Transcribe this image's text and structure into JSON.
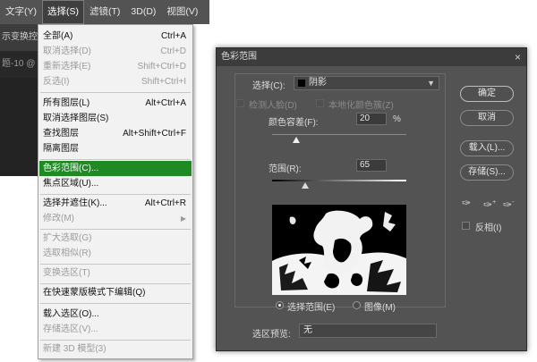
{
  "menubar": {
    "items": [
      {
        "label": "文字(Y)"
      },
      {
        "label": "选择(S)"
      },
      {
        "label": "滤镜(T)"
      },
      {
        "label": "3D(D)"
      },
      {
        "label": "视图(V)"
      }
    ],
    "active_index": 1
  },
  "options_bar": {
    "text": "示变换控件"
  },
  "document_tab": {
    "text": "题-10 @"
  },
  "select_menu": {
    "items": [
      {
        "label": "全部(A)",
        "shortcut": "Ctrl+A",
        "enabled": true
      },
      {
        "label": "取消选择(D)",
        "shortcut": "Ctrl+D",
        "enabled": false
      },
      {
        "label": "重新选择(E)",
        "shortcut": "Shift+Ctrl+D",
        "enabled": false
      },
      {
        "label": "反选(I)",
        "shortcut": "Shift+Ctrl+I",
        "enabled": false
      },
      {
        "label": "所有图层(L)",
        "shortcut": "Alt+Ctrl+A",
        "enabled": true
      },
      {
        "label": "取消选择图层(S)",
        "shortcut": "",
        "enabled": true
      },
      {
        "label": "查找图层",
        "shortcut": "Alt+Shift+Ctrl+F",
        "enabled": true
      },
      {
        "label": "隔离图层",
        "shortcut": "",
        "enabled": true
      },
      {
        "label": "色彩范围(C)...",
        "shortcut": "",
        "enabled": true,
        "highlighted": true
      },
      {
        "label": "焦点区域(U)...",
        "shortcut": "",
        "enabled": true
      },
      {
        "label": "选择并遮住(K)...",
        "shortcut": "Alt+Ctrl+R",
        "enabled": true
      },
      {
        "label": "修改(M)",
        "shortcut": "",
        "enabled": false,
        "submenu": true
      },
      {
        "label": "扩大选取(G)",
        "shortcut": "",
        "enabled": false
      },
      {
        "label": "选取相似(R)",
        "shortcut": "",
        "enabled": false
      },
      {
        "label": "变换选区(T)",
        "shortcut": "",
        "enabled": false
      },
      {
        "label": "在快速蒙版模式下编辑(Q)",
        "shortcut": "",
        "enabled": true
      },
      {
        "label": "载入选区(O)...",
        "shortcut": "",
        "enabled": true
      },
      {
        "label": "存储选区(V)...",
        "shortcut": "",
        "enabled": false
      },
      {
        "label": "新建 3D 模型(3)",
        "shortcut": "",
        "enabled": false
      }
    ]
  },
  "dialog": {
    "title": "色彩范围",
    "select_label": "选择(C):",
    "select_value": "阴影",
    "detect_faces_label": "检测人脸(D)",
    "localized_label": "本地化颜色簇(Z)",
    "fuzziness_label": "颜色容差(F):",
    "fuzziness_value": "20",
    "fuzziness_unit": "%",
    "range_label": "范围(R):",
    "range_value": "65",
    "radio_selection": "选择范围(E)",
    "radio_image": "图像(M)",
    "preview_label": "选区预览:",
    "preview_value": "无",
    "ok": "确定",
    "cancel": "取消",
    "load": "载入(L)...",
    "save": "存储(S)...",
    "invert_label": "反相(I)",
    "close_glyph": "×"
  },
  "icons": {
    "eyedropper": "eyedropper-icon",
    "eyedropper_plus": "eyedropper-plus-icon",
    "eyedropper_minus": "eyedropper-minus-icon"
  },
  "colors": {
    "menu_highlight": "#1f8a23",
    "dialog_bg": "#535353"
  }
}
